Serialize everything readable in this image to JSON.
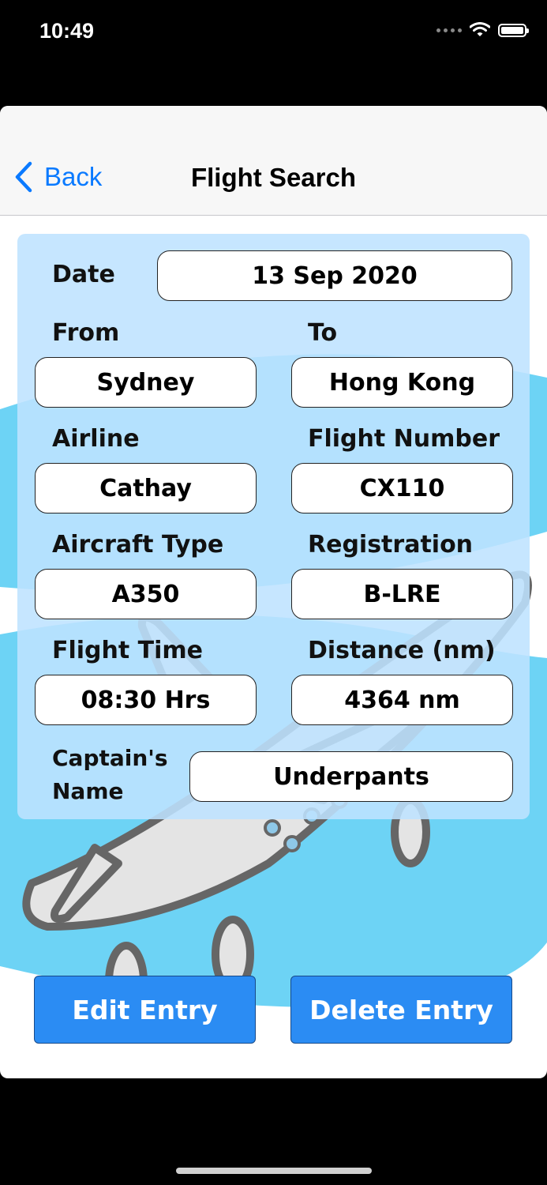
{
  "status_bar": {
    "time": "10:49"
  },
  "nav": {
    "back_label": "Back",
    "title": "Flight Search"
  },
  "form": {
    "date": {
      "label": "Date",
      "value": "13 Sep 2020"
    },
    "from": {
      "label": "From",
      "value": "Sydney"
    },
    "to": {
      "label": "To",
      "value": "Hong Kong"
    },
    "airline": {
      "label": "Airline",
      "value": "Cathay"
    },
    "flight_number": {
      "label": "Flight Number",
      "value": "CX110"
    },
    "aircraft_type": {
      "label": "Aircraft Type",
      "value": "A350"
    },
    "registration": {
      "label": "Registration",
      "value": "B-LRE"
    },
    "flight_time": {
      "label": "Flight Time",
      "value": "08:30 Hrs"
    },
    "distance": {
      "label": "Distance (nm)",
      "value": "4364 nm"
    },
    "captain": {
      "label_line1": "Captain's",
      "label_line2": "Name",
      "value": "Underpants"
    }
  },
  "actions": {
    "edit_label": "Edit Entry",
    "delete_label": "Delete Entry"
  },
  "colors": {
    "accent": "#0a7aff",
    "button": "#2b8cf3",
    "sky": "#6dd3f5",
    "card": "#bee2ff"
  }
}
